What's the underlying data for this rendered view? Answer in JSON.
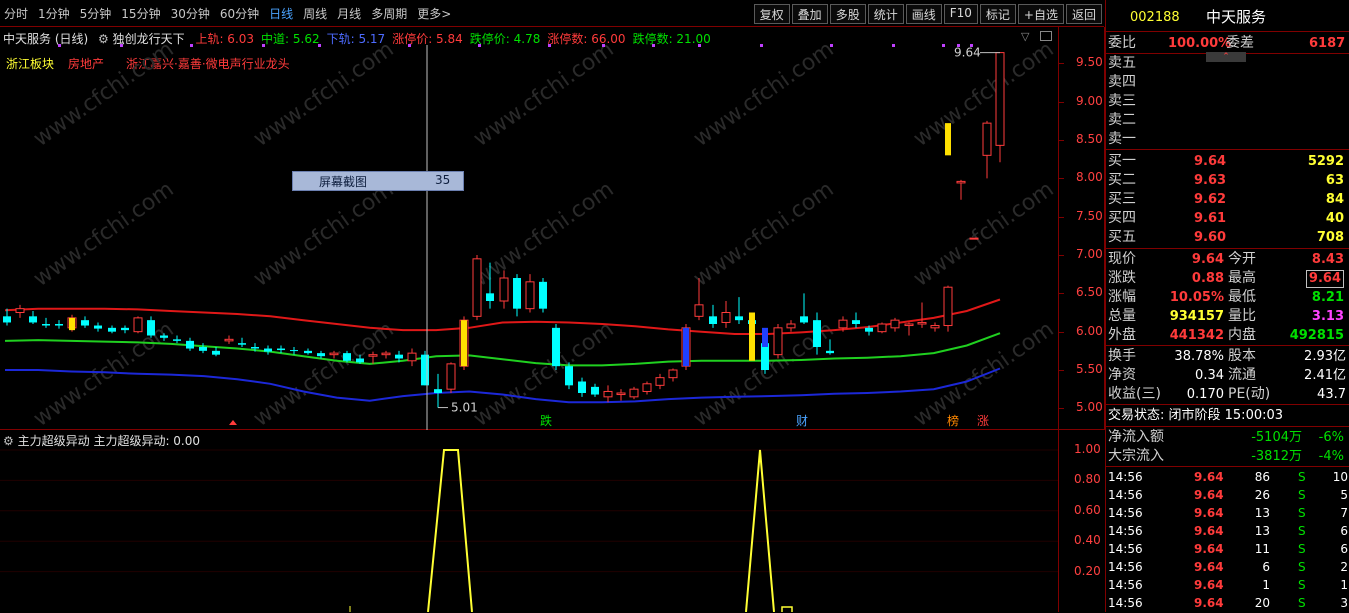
{
  "toolbar": {
    "periods": [
      "分时",
      "1分钟",
      "5分钟",
      "15分钟",
      "30分钟",
      "60分钟",
      "日线",
      "周线",
      "月线",
      "多周期",
      "更多>"
    ],
    "active_period": "日线",
    "tools": [
      "复权",
      "叠加",
      "多股",
      "统计",
      "画线",
      "F10",
      "标记",
      "+自选",
      "返回"
    ]
  },
  "chart_header": {
    "stock": "中天服务 (日线)",
    "indicator": "独创龙行天下",
    "items": [
      {
        "label": "上轨: 6.03",
        "color": "#ff3b3b"
      },
      {
        "label": "中道: 5.62",
        "color": "#00e000"
      },
      {
        "label": "下轨: 5.17",
        "color": "#4d6bff"
      },
      {
        "label": "涨停价: 5.84",
        "color": "#ff3b3b"
      },
      {
        "label": "跌停价: 4.78",
        "color": "#00e000"
      },
      {
        "label": "涨停数: 66.00",
        "color": "#ff3b3b"
      },
      {
        "label": "跌停数: 21.00",
        "color": "#00e000"
      }
    ],
    "tags": [
      {
        "label": "浙江板块",
        "color": "#ffff33"
      },
      {
        "label": "房地产",
        "color": "#ff3b3b"
      },
      {
        "label": "浙江嘉兴·嘉善·微电声行业龙头",
        "color": "#ff3b3b"
      }
    ]
  },
  "tooltip": {
    "label": "屏幕截图",
    "value": "35"
  },
  "price_axis": [
    "9.50",
    "9.00",
    "8.50",
    "8.00",
    "7.50",
    "7.00",
    "6.50",
    "6.00",
    "5.50",
    "5.00"
  ],
  "markers": {
    "high": "9.64",
    "low": "5.01"
  },
  "signal_marks": [
    {
      "text": "跌",
      "color": "#00e000"
    },
    {
      "text": "财",
      "color": "#4aa3ff"
    },
    {
      "text": "榜",
      "color": "#ff8800"
    },
    {
      "text": "涨",
      "color": "#ff3b3b"
    }
  ],
  "sub_indicator": {
    "title": "主力超级异动",
    "line": "主力超级异动: 0.00",
    "axis": [
      "1.00",
      "0.80",
      "0.60",
      "0.40",
      "0.20"
    ]
  },
  "right_panel": {
    "code": "002188",
    "name": "中天服务",
    "webi_label": "委比",
    "webi": "100.00%",
    "weicha_label": "委差",
    "weicha": "6187",
    "sells": [
      {
        "label": "卖五",
        "price": "",
        "vol": ""
      },
      {
        "label": "卖四",
        "price": "",
        "vol": ""
      },
      {
        "label": "卖三",
        "price": "",
        "vol": ""
      },
      {
        "label": "卖二",
        "price": "",
        "vol": ""
      },
      {
        "label": "卖一",
        "price": "",
        "vol": ""
      }
    ],
    "buys": [
      {
        "label": "买一",
        "price": "9.64",
        "vol": "5292"
      },
      {
        "label": "买二",
        "price": "9.63",
        "vol": "63"
      },
      {
        "label": "买三",
        "price": "9.62",
        "vol": "84"
      },
      {
        "label": "买四",
        "price": "9.61",
        "vol": "40"
      },
      {
        "label": "买五",
        "price": "9.60",
        "vol": "708"
      }
    ],
    "quote": [
      {
        "l1": "现价",
        "v1": "9.64",
        "c1": "red",
        "l2": "今开",
        "v2": "8.43",
        "c2": "red"
      },
      {
        "l1": "涨跌",
        "v1": "0.88",
        "c1": "red",
        "l2": "最高",
        "v2": "9.64",
        "c2": "red"
      },
      {
        "l1": "涨幅",
        "v1": "10.05%",
        "c1": "red",
        "l2": "最低",
        "v2": "8.21",
        "c2": "green"
      },
      {
        "l1": "总量",
        "v1": "934157",
        "c1": "yellow",
        "l2": "量比",
        "v2": "3.13",
        "c2": "magenta"
      },
      {
        "l1": "外盘",
        "v1": "441342",
        "c1": "red",
        "l2": "内盘",
        "v2": "492815",
        "c2": "green"
      }
    ],
    "stats": [
      {
        "l1": "换手",
        "v1": "38.78%",
        "l2": "股本",
        "v2": "2.93亿"
      },
      {
        "l1": "净资",
        "v1": "0.34",
        "l2": "流通",
        "v2": "2.41亿"
      },
      {
        "l1": "收益(三)",
        "v1": "0.170",
        "l2": "PE(动)",
        "v2": "43.7"
      }
    ],
    "trade_status": "交易状态: 闭市阶段 15:00:03",
    "flows": [
      {
        "label": "净流入额",
        "value": "-5104万",
        "pct": "-6%"
      },
      {
        "label": "大宗流入",
        "value": "-3812万",
        "pct": "-4%"
      }
    ],
    "ticks": [
      {
        "time": "14:56",
        "price": "9.64",
        "vol": "86",
        "side": "S",
        "n": "10"
      },
      {
        "time": "14:56",
        "price": "9.64",
        "vol": "26",
        "side": "S",
        "n": "5"
      },
      {
        "time": "14:56",
        "price": "9.64",
        "vol": "13",
        "side": "S",
        "n": "7"
      },
      {
        "time": "14:56",
        "price": "9.64",
        "vol": "13",
        "side": "S",
        "n": "6"
      },
      {
        "time": "14:56",
        "price": "9.64",
        "vol": "11",
        "side": "S",
        "n": "6"
      },
      {
        "time": "14:56",
        "price": "9.64",
        "vol": "6",
        "side": "S",
        "n": "2"
      },
      {
        "time": "14:56",
        "price": "9.64",
        "vol": "1",
        "side": "S",
        "n": "1"
      },
      {
        "time": "14:56",
        "price": "9.64",
        "vol": "20",
        "side": "S",
        "n": "3"
      }
    ]
  },
  "watermark": "www.cfchi.com",
  "chart_data": {
    "type": "candlestick",
    "y_range": [
      4.9,
      9.7
    ],
    "candles": [
      {
        "o": 6.2,
        "h": 6.3,
        "l": 6.08,
        "c": 6.12
      },
      {
        "o": 6.25,
        "h": 6.35,
        "l": 6.18,
        "c": 6.3
      },
      {
        "o": 6.2,
        "h": 6.27,
        "l": 6.1,
        "c": 6.12
      },
      {
        "o": 6.1,
        "h": 6.18,
        "l": 6.05,
        "c": 6.08
      },
      {
        "o": 6.1,
        "h": 6.15,
        "l": 6.04,
        "c": 6.08
      },
      {
        "o": 6.05,
        "h": 6.22,
        "l": 6.0,
        "c": 6.18
      },
      {
        "o": 6.15,
        "h": 6.2,
        "l": 6.05,
        "c": 6.08
      },
      {
        "o": 6.08,
        "h": 6.12,
        "l": 6.0,
        "c": 6.04
      },
      {
        "o": 6.05,
        "h": 6.08,
        "l": 5.98,
        "c": 6.0
      },
      {
        "o": 6.05,
        "h": 6.08,
        "l": 5.98,
        "c": 6.02
      },
      {
        "o": 6.0,
        "h": 6.2,
        "l": 5.98,
        "c": 6.18
      },
      {
        "o": 6.15,
        "h": 6.2,
        "l": 5.92,
        "c": 5.95
      },
      {
        "o": 5.95,
        "h": 5.98,
        "l": 5.88,
        "c": 5.92
      },
      {
        "o": 5.9,
        "h": 5.95,
        "l": 5.85,
        "c": 5.88
      },
      {
        "o": 5.88,
        "h": 5.92,
        "l": 5.75,
        "c": 5.78
      },
      {
        "o": 5.8,
        "h": 5.85,
        "l": 5.72,
        "c": 5.75
      },
      {
        "o": 5.75,
        "h": 5.8,
        "l": 5.68,
        "c": 5.7
      },
      {
        "o": 5.88,
        "h": 5.95,
        "l": 5.84,
        "c": 5.9
      },
      {
        "o": 5.85,
        "h": 5.92,
        "l": 5.8,
        "c": 5.83
      },
      {
        "o": 5.8,
        "h": 5.85,
        "l": 5.74,
        "c": 5.78
      },
      {
        "o": 5.78,
        "h": 5.82,
        "l": 5.7,
        "c": 5.74
      },
      {
        "o": 5.78,
        "h": 5.82,
        "l": 5.72,
        "c": 5.76
      },
      {
        "o": 5.76,
        "h": 5.8,
        "l": 5.7,
        "c": 5.75
      },
      {
        "o": 5.75,
        "h": 5.78,
        "l": 5.7,
        "c": 5.72
      },
      {
        "o": 5.72,
        "h": 5.75,
        "l": 5.65,
        "c": 5.68
      },
      {
        "o": 5.7,
        "h": 5.75,
        "l": 5.65,
        "c": 5.72
      },
      {
        "o": 5.72,
        "h": 5.75,
        "l": 5.6,
        "c": 5.62
      },
      {
        "o": 5.65,
        "h": 5.7,
        "l": 5.58,
        "c": 5.6
      },
      {
        "o": 5.68,
        "h": 5.74,
        "l": 5.58,
        "c": 5.7
      },
      {
        "o": 5.7,
        "h": 5.75,
        "l": 5.65,
        "c": 5.72
      },
      {
        "o": 5.7,
        "h": 5.75,
        "l": 5.6,
        "c": 5.65
      },
      {
        "o": 5.62,
        "h": 5.78,
        "l": 5.55,
        "c": 5.72
      },
      {
        "o": 5.7,
        "h": 5.75,
        "l": 5.3,
        "c": 5.3
      },
      {
        "o": 5.25,
        "h": 5.45,
        "l": 5.01,
        "c": 5.2
      },
      {
        "o": 5.25,
        "h": 5.6,
        "l": 5.2,
        "c": 5.58
      },
      {
        "o": 5.55,
        "h": 6.2,
        "l": 5.5,
        "c": 6.15
      },
      {
        "o": 6.2,
        "h": 7.0,
        "l": 6.15,
        "c": 6.95
      },
      {
        "o": 6.5,
        "h": 6.9,
        "l": 6.3,
        "c": 6.4
      },
      {
        "o": 6.4,
        "h": 6.8,
        "l": 6.3,
        "c": 6.7
      },
      {
        "o": 6.7,
        "h": 6.75,
        "l": 6.2,
        "c": 6.3
      },
      {
        "o": 6.3,
        "h": 6.75,
        "l": 6.25,
        "c": 6.65
      },
      {
        "o": 6.65,
        "h": 6.7,
        "l": 6.25,
        "c": 6.3
      },
      {
        "o": 6.05,
        "h": 6.1,
        "l": 5.5,
        "c": 5.55
      },
      {
        "o": 5.55,
        "h": 5.6,
        "l": 5.25,
        "c": 5.3
      },
      {
        "o": 5.35,
        "h": 5.4,
        "l": 5.15,
        "c": 5.2
      },
      {
        "o": 5.28,
        "h": 5.32,
        "l": 5.15,
        "c": 5.18
      },
      {
        "o": 5.15,
        "h": 5.3,
        "l": 5.08,
        "c": 5.22
      },
      {
        "o": 5.18,
        "h": 5.25,
        "l": 5.1,
        "c": 5.2
      },
      {
        "o": 5.15,
        "h": 5.28,
        "l": 5.12,
        "c": 5.25
      },
      {
        "o": 5.22,
        "h": 5.35,
        "l": 5.18,
        "c": 5.32
      },
      {
        "o": 5.3,
        "h": 5.45,
        "l": 5.25,
        "c": 5.4
      },
      {
        "o": 5.4,
        "h": 5.52,
        "l": 5.35,
        "c": 5.5
      },
      {
        "o": 5.55,
        "h": 6.1,
        "l": 5.5,
        "c": 6.05
      },
      {
        "o": 6.2,
        "h": 6.7,
        "l": 6.15,
        "c": 6.35
      },
      {
        "o": 6.2,
        "h": 6.35,
        "l": 6.05,
        "c": 6.1
      },
      {
        "o": 6.12,
        "h": 6.4,
        "l": 6.05,
        "c": 6.25
      },
      {
        "o": 6.2,
        "h": 6.45,
        "l": 6.1,
        "c": 6.15
      },
      {
        "o": 6.15,
        "h": 6.25,
        "l": 6.05,
        "c": 6.1
      },
      {
        "o": 5.85,
        "h": 5.9,
        "l": 5.45,
        "c": 5.5
      },
      {
        "o": 5.7,
        "h": 6.1,
        "l": 5.65,
        "c": 6.05
      },
      {
        "o": 6.05,
        "h": 6.15,
        "l": 6.0,
        "c": 6.1
      },
      {
        "o": 6.2,
        "h": 6.5,
        "l": 6.1,
        "c": 6.12
      },
      {
        "o": 6.15,
        "h": 6.25,
        "l": 5.7,
        "c": 5.8
      },
      {
        "o": 5.75,
        "h": 5.9,
        "l": 5.7,
        "c": 5.72
      },
      {
        "o": 6.05,
        "h": 6.2,
        "l": 6.0,
        "c": 6.15
      },
      {
        "o": 6.15,
        "h": 6.25,
        "l": 6.05,
        "c": 6.1
      },
      {
        "o": 6.05,
        "h": 6.08,
        "l": 5.95,
        "c": 6.0
      },
      {
        "o": 6.0,
        "h": 6.12,
        "l": 5.98,
        "c": 6.1
      },
      {
        "o": 6.05,
        "h": 6.18,
        "l": 6.0,
        "c": 6.15
      },
      {
        "o": 6.08,
        "h": 6.12,
        "l": 5.95,
        "c": 6.1
      },
      {
        "o": 6.1,
        "h": 6.38,
        "l": 6.05,
        "c": 6.12
      },
      {
        "o": 6.05,
        "h": 6.12,
        "l": 6.0,
        "c": 6.08
      },
      {
        "o": 6.08,
        "h": 6.6,
        "l": 6.0,
        "c": 6.58
      },
      {
        "o": 7.94,
        "h": 7.98,
        "l": 7.72,
        "c": 7.96
      },
      {
        "o": 7.22,
        "h": 7.22,
        "l": 7.22,
        "c": 7.22
      },
      {
        "o": 8.3,
        "h": 8.75,
        "l": 8.0,
        "c": 8.72
      },
      {
        "o": 8.43,
        "h": 9.64,
        "l": 8.21,
        "c": 9.64
      }
    ],
    "bands": {
      "upper": [
        6.28,
        6.3,
        6.3,
        6.3,
        6.29,
        6.27,
        6.25,
        6.23,
        6.2,
        6.15,
        6.1,
        6.05,
        6.02,
        6.02,
        6.05,
        6.12,
        6.13,
        6.12,
        6.1,
        6.07,
        6.03,
        6.0,
        5.97,
        5.97,
        5.99,
        6.02,
        6.06,
        6.12,
        6.18,
        6.27,
        6.42
      ],
      "middle": [
        5.88,
        5.89,
        5.88,
        5.87,
        5.86,
        5.84,
        5.81,
        5.78,
        5.74,
        5.68,
        5.62,
        5.58,
        5.62,
        5.68,
        5.69,
        5.64,
        5.59,
        5.56,
        5.56,
        5.58,
        5.61,
        5.62,
        5.62,
        5.62,
        5.63,
        5.65,
        5.66,
        5.68,
        5.72,
        5.82,
        5.98
      ],
      "lower": [
        5.5,
        5.5,
        5.48,
        5.47,
        5.45,
        5.44,
        5.42,
        5.38,
        5.32,
        5.22,
        5.14,
        5.1,
        5.16,
        5.2,
        5.22,
        5.18,
        5.12,
        5.08,
        5.08,
        5.09,
        5.12,
        5.14,
        5.15,
        5.16,
        5.17,
        5.19,
        5.2,
        5.22,
        5.25,
        5.35,
        5.52
      ]
    },
    "sub_signal_range": [
      0,
      1.05
    ]
  }
}
